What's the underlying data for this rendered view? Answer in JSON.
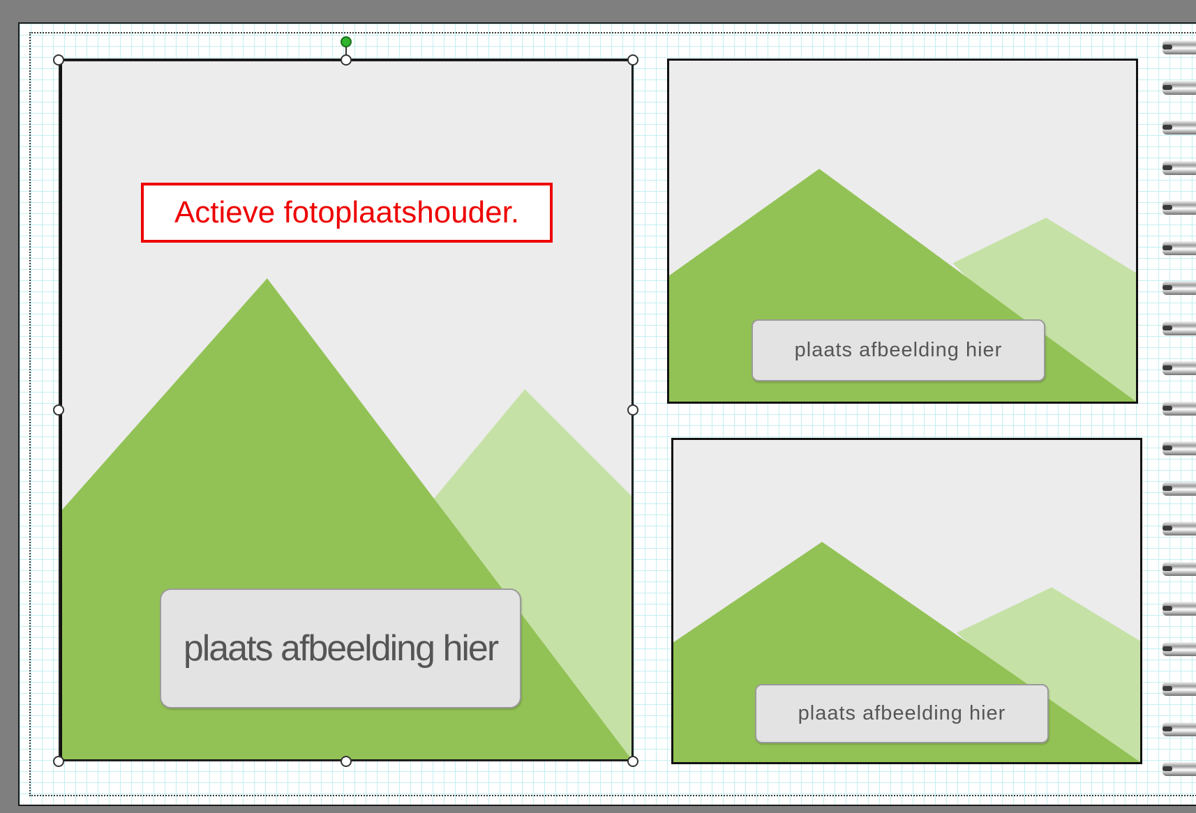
{
  "editor": {
    "page_name": "album-page",
    "grid_color": "#c4eef0",
    "selection_handle_color": "#ffffff",
    "rotate_handle_color": "#2fb52f"
  },
  "placeholders": {
    "main": {
      "label": "plaats afbeelding hier",
      "selected": true
    },
    "top_right": {
      "label": "plaats afbeelding hier",
      "selected": false
    },
    "bottom_right": {
      "label": "plaats afbeelding hier",
      "selected": false
    }
  },
  "colors": {
    "placeholder_bg": "#ececec",
    "mountain_dark": "#92c255",
    "mountain_light": "#c6e1a6",
    "callout": "#ee0000"
  },
  "annotation": {
    "text": "Actieve fotoplaatshouder."
  },
  "icons": [
    "resize-handle-icon",
    "rotate-handle-icon",
    "spiral-binding-icon"
  ]
}
